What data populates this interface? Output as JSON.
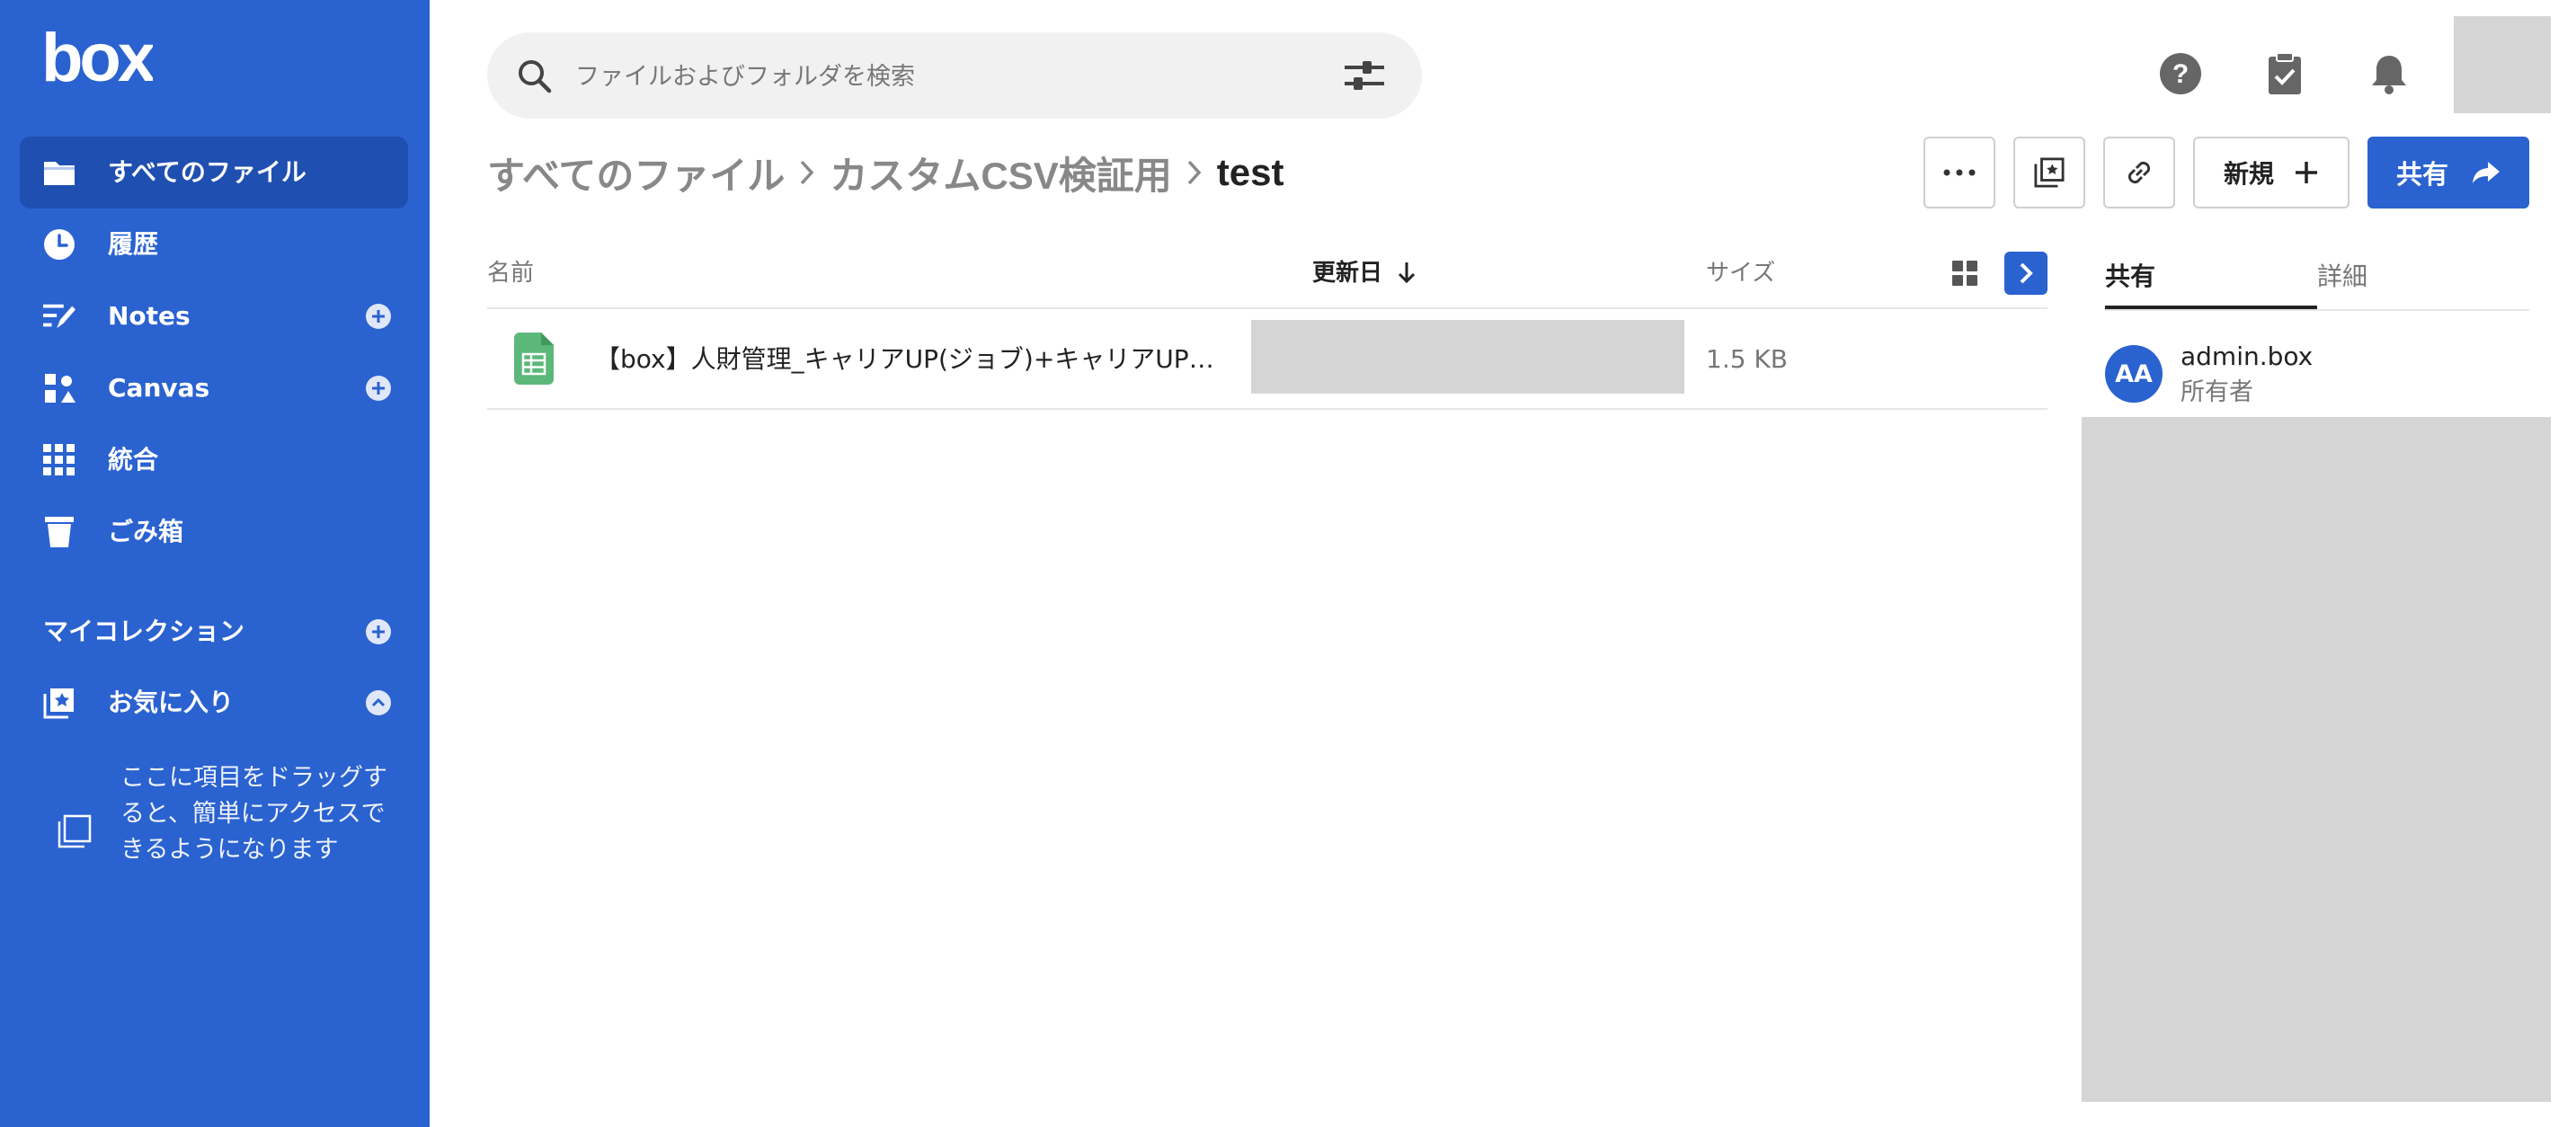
{
  "brand": {
    "logo_text": "box"
  },
  "sidebar": {
    "items": [
      {
        "label": "すべてのファイル",
        "icon": "folder-icon",
        "active": true
      },
      {
        "label": "履歴",
        "icon": "clock-icon"
      },
      {
        "label": "Notes",
        "icon": "notes-icon",
        "has_add": true
      },
      {
        "label": "Canvas",
        "icon": "canvas-icon",
        "has_add": true
      },
      {
        "label": "統合",
        "icon": "apps-grid-icon"
      },
      {
        "label": "ごみ箱",
        "icon": "trash-icon"
      }
    ],
    "collections_title": "マイコレクション",
    "favorites": {
      "label": "お気に入り",
      "icon": "favorites-icon",
      "expanded": true
    },
    "favorites_hint": "ここに項目をドラッグすると、簡単にアクセスできるようになります"
  },
  "header": {
    "search_placeholder": "ファイルおよびフォルダを検索",
    "icons": [
      "help-icon",
      "tasks-icon",
      "bell-icon"
    ]
  },
  "breadcrumb": {
    "items": [
      "すべてのファイル",
      "カスタムCSV検証用"
    ],
    "current": "test"
  },
  "toolbar": {
    "more_icon": "more-icon",
    "collections_icon": "add-to-collection-icon",
    "link_icon": "link-icon",
    "new_label": "新規",
    "share_label": "共有"
  },
  "file_list": {
    "columns": {
      "name": "名前",
      "updated": "更新日",
      "size": "サイズ"
    },
    "sort": {
      "column": "updated",
      "direction": "desc"
    },
    "rows": [
      {
        "name": "【box】人財管理_キャリアUP(ジョブ)+キャリアUP(…",
        "size": "1.5 KB",
        "type": "spreadsheet"
      }
    ]
  },
  "details_panel": {
    "tabs": [
      "共有",
      "詳細"
    ],
    "active_tab": "共有",
    "owner": {
      "initials": "AA",
      "name": "admin.box",
      "role": "所有者"
    }
  },
  "colors": {
    "brand": "#2a62d0",
    "brand_dark": "#1f4fb0",
    "sheet_green": "#5cb87a",
    "redacted": "#d5d5d5"
  }
}
